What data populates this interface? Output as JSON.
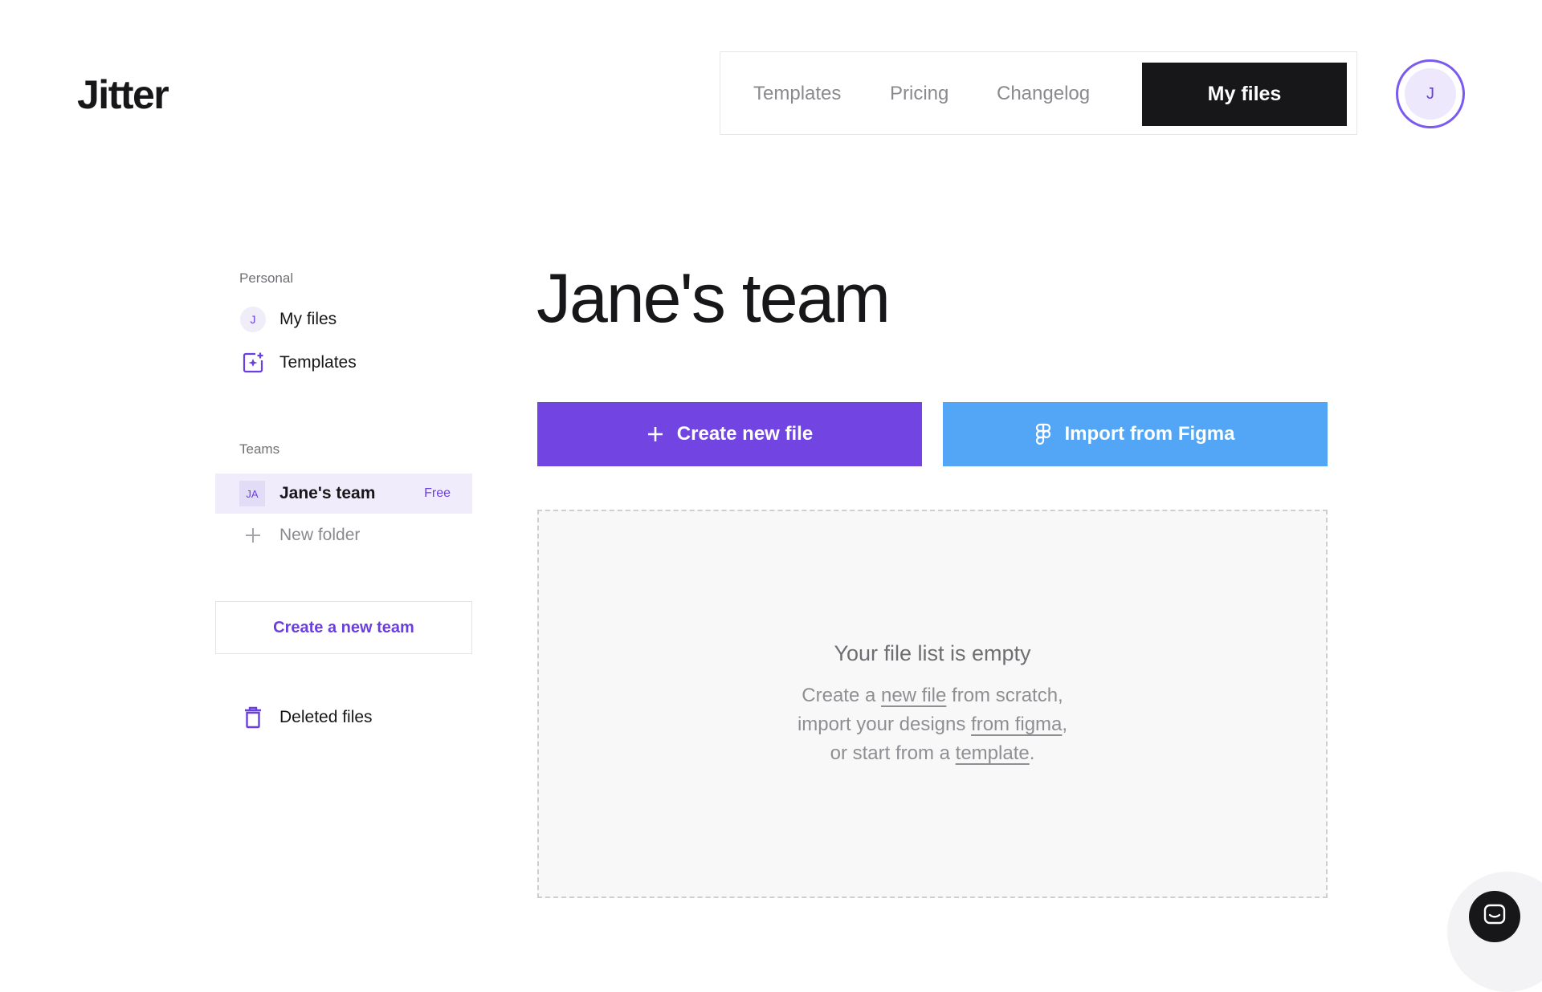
{
  "brand": {
    "logo_text": "Jitter"
  },
  "topnav": {
    "links": [
      {
        "label": "Templates"
      },
      {
        "label": "Pricing"
      },
      {
        "label": "Changelog"
      }
    ],
    "cta_label": "My files"
  },
  "user": {
    "initial": "J"
  },
  "sidebar": {
    "personal_heading": "Personal",
    "personal_items": [
      {
        "label": "My files",
        "icon": "user-avatar",
        "avatar_initial": "J"
      },
      {
        "label": "Templates",
        "icon": "template-sparkle-icon"
      }
    ],
    "teams_heading": "Teams",
    "team": {
      "initials": "JA",
      "name": "Jane's team",
      "plan": "Free"
    },
    "new_folder_label": "New folder",
    "create_team_label": "Create a new team",
    "deleted_files_label": "Deleted files"
  },
  "main": {
    "title": "Jane's team",
    "create_button_label": "Create new file",
    "import_button_label": "Import from Figma",
    "empty": {
      "title": "Your file list is empty",
      "line1_prefix": "Create a ",
      "line1_link": "new file",
      "line1_suffix": " from scratch,",
      "line2_prefix": "import your designs ",
      "line2_link": "from figma",
      "line2_suffix": ",",
      "line3_prefix": "or start from a ",
      "line3_link": "template",
      "line3_suffix": "."
    }
  },
  "colors": {
    "accent": "#7244e2",
    "figma_blue": "#52a6f5",
    "dark": "#17171a",
    "selected_bg": "#f0ecfc"
  }
}
